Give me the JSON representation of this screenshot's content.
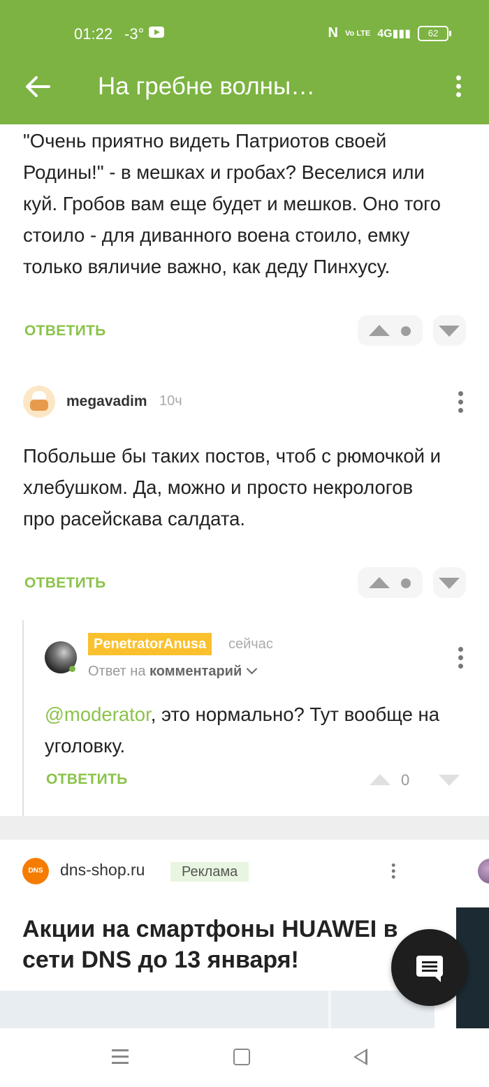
{
  "status_bar": {
    "time": "01:22",
    "temperature": "-3°",
    "network": "4G",
    "volte": "Vo LTE",
    "battery": "62"
  },
  "header": {
    "title": "На гребне волны…",
    "accent_color": "#7cb342"
  },
  "comments": [
    {
      "text": "\"Очень приятно видеть Патриотов своей Родины!\" - в мешках и гробах? Веселися или куй. Гробов вам еще будет и мешков. Оно того стоило - для диванного воена стоило, емку только вяличие важно, как деду Пинхусу.",
      "reply_label": "ОТВЕТИТЬ"
    },
    {
      "username": "megavadim",
      "time": "10ч",
      "text": "Побольше бы таких постов, чтоб с рюмочкой и хлебушком. Да, можно и просто некрологов про расейскава салдата.",
      "reply_label": "ОТВЕТИТЬ"
    },
    {
      "username": "PenetratorAnusa",
      "time": "сейчас",
      "reply_to_prefix": "Ответ на",
      "reply_to_target": "комментарий",
      "mention": "@moderator",
      "text_rest": ", это нормально? Тут вообще на уголовку.",
      "reply_label": "ОТВЕТИТЬ",
      "score": "0"
    }
  ],
  "ad": {
    "logo_text": "DNS",
    "site": "dns-shop.ru",
    "badge": "Реклама",
    "title": "Акции на смартфоны HUAWEI в сети DNS до 13 января!"
  }
}
